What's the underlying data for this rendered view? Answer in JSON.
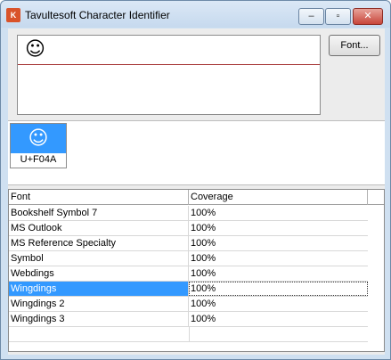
{
  "window": {
    "title": "Tavultesoft Character Identifier",
    "minimize": "‒",
    "maximize": "▫",
    "close": "✕"
  },
  "input": {
    "character": "☺"
  },
  "font_button": {
    "label": "Font..."
  },
  "selected_glyph": {
    "glyph": "☺",
    "code": "U+F04A"
  },
  "font_list": {
    "columns": [
      "Font",
      "Coverage"
    ],
    "rows": [
      {
        "font": "Bookshelf Symbol 7",
        "coverage": "100%"
      },
      {
        "font": "MS Outlook",
        "coverage": "100%"
      },
      {
        "font": "MS Reference Specialty",
        "coverage": "100%"
      },
      {
        "font": "Symbol",
        "coverage": "100%"
      },
      {
        "font": "Webdings",
        "coverage": "100%"
      },
      {
        "font": "Wingdings",
        "coverage": "100%"
      },
      {
        "font": "Wingdings 2",
        "coverage": "100%"
      },
      {
        "font": "Wingdings 3",
        "coverage": "100%"
      }
    ],
    "selected_index": 5
  }
}
